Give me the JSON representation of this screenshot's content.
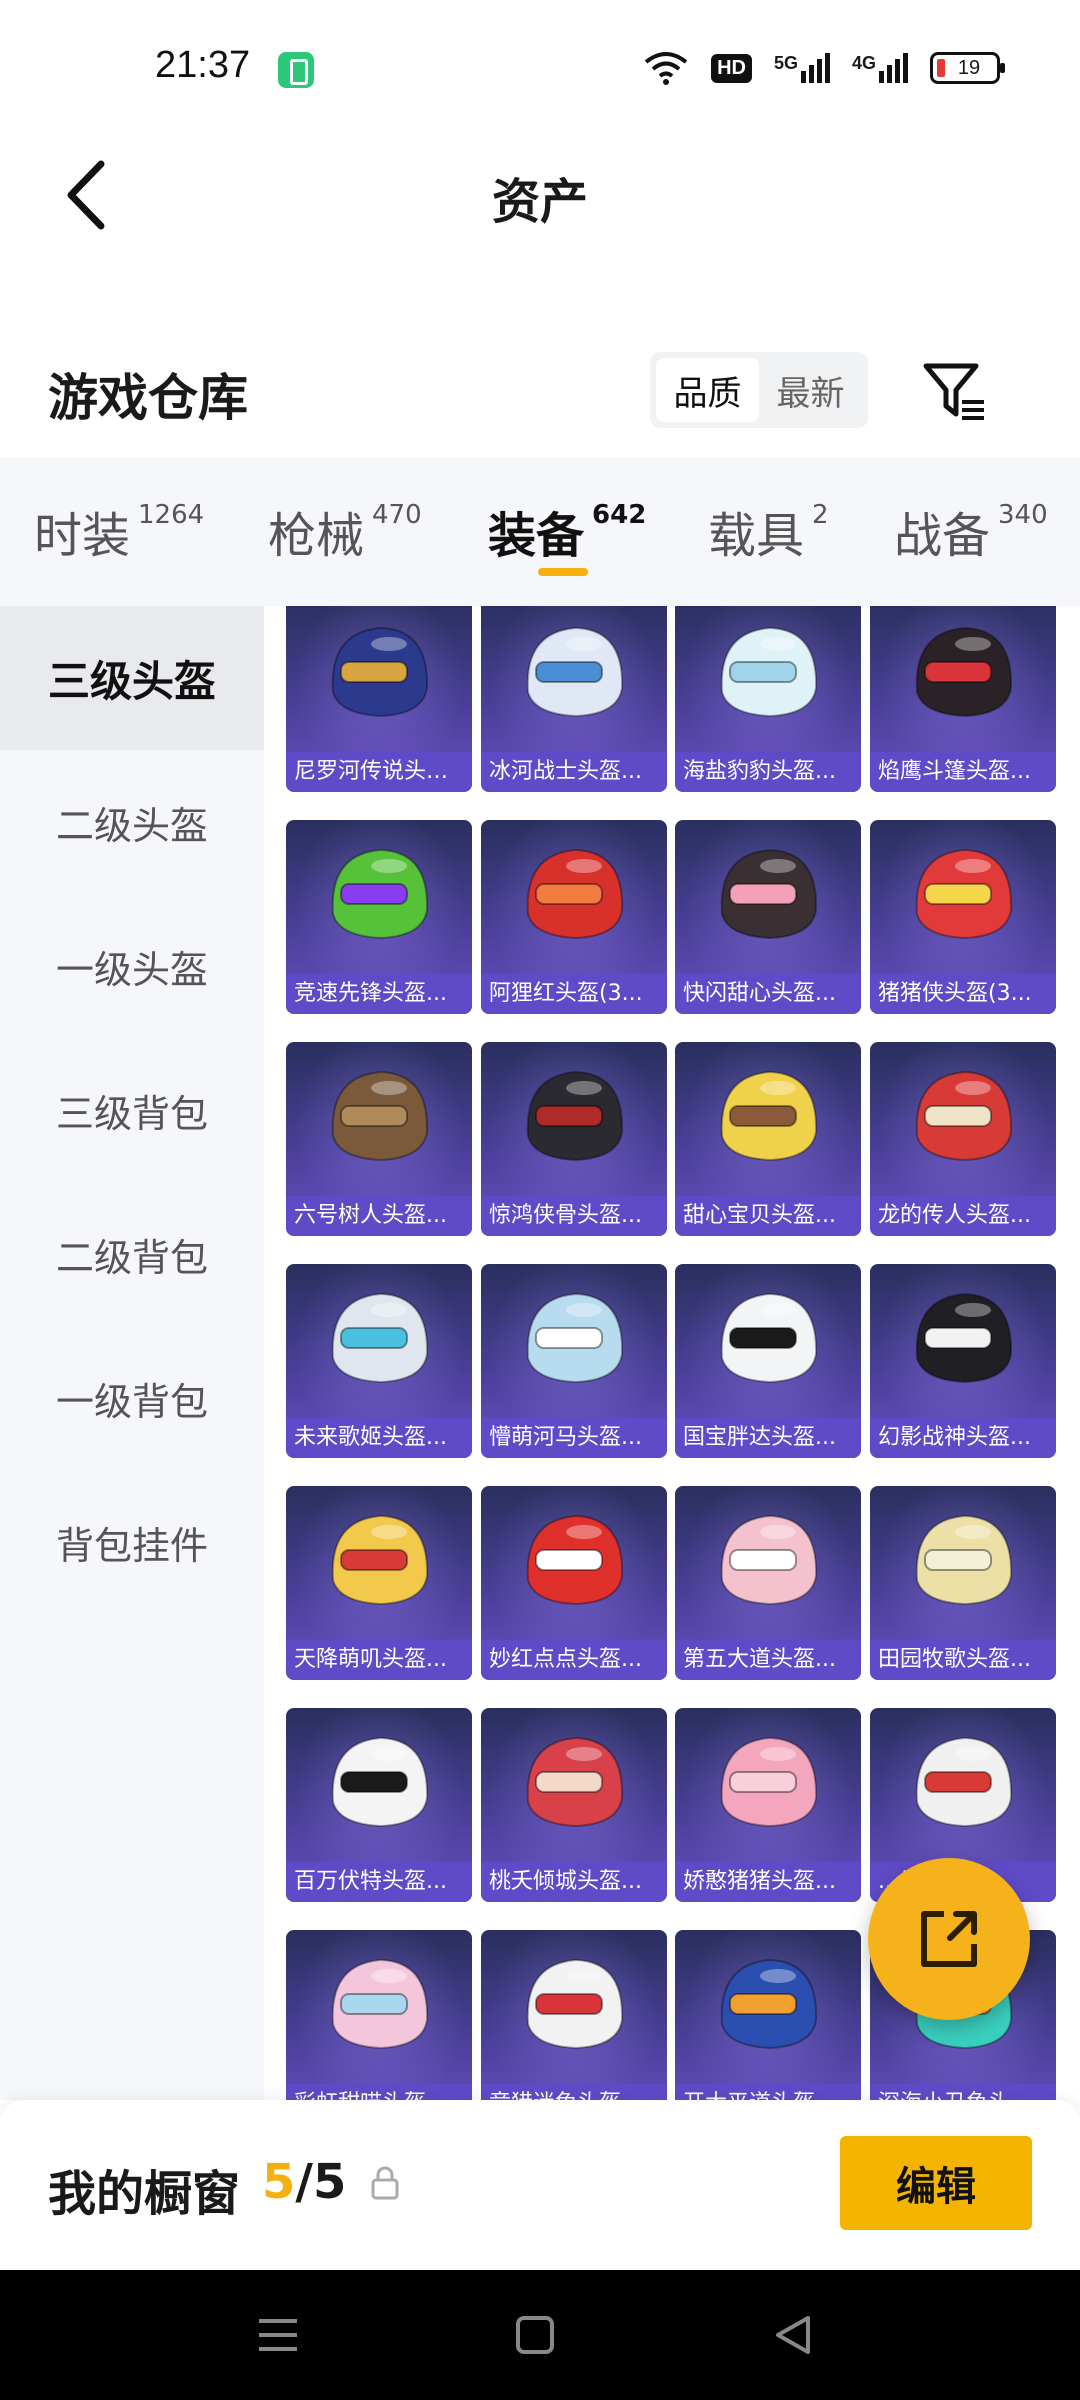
{
  "status_bar": {
    "time": "21:37",
    "hd_label": "HD",
    "net1_label": "5G",
    "net2_label": "4G",
    "battery_level": "19"
  },
  "header": {
    "title": "资产"
  },
  "warehouse": {
    "title": "游戏仓库",
    "sort_options": [
      "品质",
      "最新"
    ],
    "selected_sort": "品质"
  },
  "tabs": [
    {
      "label": "时装",
      "count": "1264"
    },
    {
      "label": "枪械",
      "count": "470"
    },
    {
      "label": "装备",
      "count": "642"
    },
    {
      "label": "载具",
      "count": "2"
    },
    {
      "label": "战备",
      "count": "340"
    }
  ],
  "active_tab": "装备",
  "sidebar": {
    "items": [
      "三级头盔",
      "二级头盔",
      "一级头盔",
      "三级背包",
      "二级背包",
      "一级背包",
      "背包挂件"
    ],
    "active": "三级头盔"
  },
  "items": [
    {
      "name": "尼罗河传说头盔...",
      "color": "#2b3a8c",
      "accent": "#d8a640"
    },
    {
      "name": "冰河战士头盔...",
      "color": "#dfe8f4",
      "accent": "#4a8fd6"
    },
    {
      "name": "海盐豹豹头盔...",
      "color": "#dff2f8",
      "accent": "#9fd4ea"
    },
    {
      "name": "焰鹰斗篷头盔...",
      "color": "#2a2226",
      "accent": "#d8343a"
    },
    {
      "name": "竞速先锋头盔...",
      "color": "#55c23a",
      "accent": "#8a3cf0"
    },
    {
      "name": "阿狸红头盔(3...",
      "color": "#d8312c",
      "accent": "#f27c40"
    },
    {
      "name": "快闪甜心头盔...",
      "color": "#3a2f32",
      "accent": "#f4a0b8"
    },
    {
      "name": "猪猪侠头盔(3...",
      "color": "#e23a3a",
      "accent": "#f5d54a"
    },
    {
      "name": "六号树人头盔...",
      "color": "#7a5a3a",
      "accent": "#b08a5a"
    },
    {
      "name": "惊鸿侠骨头盔...",
      "color": "#2a2a30",
      "accent": "#b02a2a"
    },
    {
      "name": "甜心宝贝头盔...",
      "color": "#f0d24a",
      "accent": "#8a5a3a"
    },
    {
      "name": "龙的传人头盔...",
      "color": "#d83a36",
      "accent": "#f0e4c8"
    },
    {
      "name": "未来歌姬头盔...",
      "color": "#dfe6ee",
      "accent": "#4ac0e0"
    },
    {
      "name": "懵萌河马头盔...",
      "color": "#b8dcef",
      "accent": "#ffffff"
    },
    {
      "name": "国宝胖达头盔...",
      "color": "#f2f4f6",
      "accent": "#1a1a1a"
    },
    {
      "name": "幻影战神头盔...",
      "color": "#202024",
      "accent": "#f2f2f2"
    },
    {
      "name": "天降萌叽头盔...",
      "color": "#f2c94a",
      "accent": "#d83a36"
    },
    {
      "name": "妙红点点头盔...",
      "color": "#e0302c",
      "accent": "#ffffff"
    },
    {
      "name": "第五大道头盔...",
      "color": "#f4c2cc",
      "accent": "#ffffff"
    },
    {
      "name": "田园牧歌头盔...",
      "color": "#ece0a6",
      "accent": "#f4f0d8"
    },
    {
      "name": "百万伏特头盔...",
      "color": "#f4f4f4",
      "accent": "#1a1a1a"
    },
    {
      "name": "桃夭倾城头盔...",
      "color": "#d8404a",
      "accent": "#f4d8c8"
    },
    {
      "name": "娇憨猪猪头盔...",
      "color": "#f4a6be",
      "accent": "#f8d0dc"
    },
    {
      "name": "...头盔...",
      "color": "#f0f0f0",
      "accent": "#d83a36"
    },
    {
      "name": "彩虹甜喵头盔...",
      "color": "#f4c6dc",
      "accent": "#a8d8f0"
    },
    {
      "name": "竞猎迷兔头盔...",
      "color": "#f2f2f2",
      "accent": "#d8343a"
    },
    {
      "name": "开大平道头盔...",
      "color": "#2a4fb0",
      "accent": "#f2a030"
    },
    {
      "name": "深海小丑鱼头盔...",
      "color": "#3ad0c0",
      "accent": "#f28a30"
    }
  ],
  "showcase": {
    "title": "我的橱窗",
    "count_current": "5",
    "count_sep": "/",
    "count_total": "5",
    "edit_label": "编辑"
  }
}
